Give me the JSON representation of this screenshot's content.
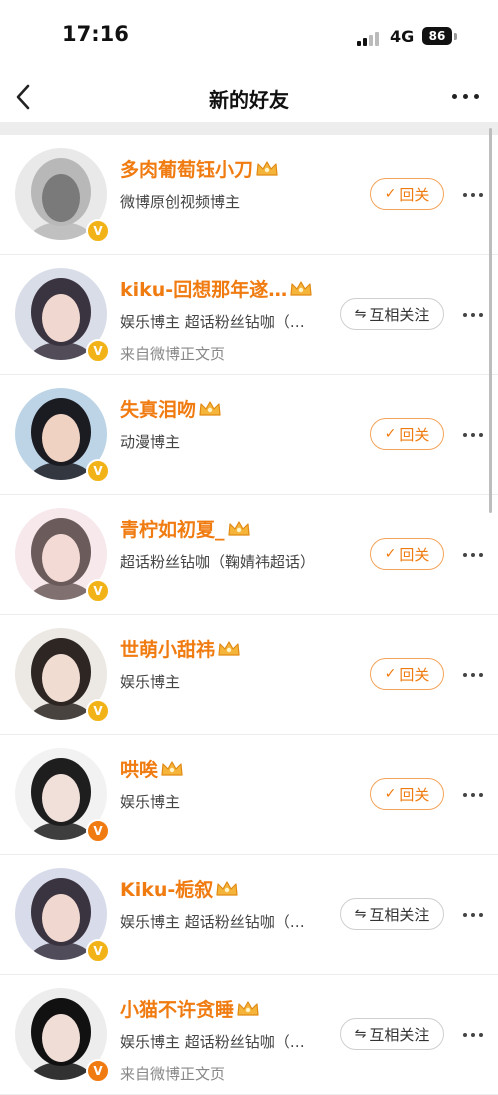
{
  "status_bar": {
    "time": "17:16",
    "network": "4G",
    "battery": "86"
  },
  "nav": {
    "title": "新的好友",
    "back_icon": "chevron-left-icon",
    "more_icon": "more-horizontal-icon"
  },
  "colors": {
    "accent": "#f07b10",
    "follow_border": "#f4a45a",
    "badge_yellow": "#f2b318",
    "badge_orange": "#f07b10"
  },
  "rows": [
    {
      "name": "多肉葡萄钰小刀",
      "desc": "微博原创视频博主",
      "source": "",
      "button": "回关",
      "button_type": "follow",
      "badge_color": "#f2b318"
    },
    {
      "name": "kiku-回想那年遂…",
      "desc": "娱乐博主 超话粉丝钻咖（…",
      "source": "来自微博正文页",
      "button": "互相关注",
      "button_type": "mutual",
      "badge_color": "#f2b318"
    },
    {
      "name": "失真泪吻",
      "desc": "动漫博主",
      "source": "",
      "button": "回关",
      "button_type": "follow",
      "badge_color": "#f2b318"
    },
    {
      "name": "青柠如初夏_",
      "desc": "超话粉丝钻咖（鞠婧祎超话）",
      "source": "",
      "button": "回关",
      "button_type": "follow",
      "badge_color": "#f2b318"
    },
    {
      "name": "世萌小甜祎",
      "desc": "娱乐博主",
      "source": "",
      "button": "回关",
      "button_type": "follow",
      "badge_color": "#f2b318"
    },
    {
      "name": "哄唉",
      "desc": "娱乐博主",
      "source": "",
      "button": "回关",
      "button_type": "follow",
      "badge_color": "#f07b10"
    },
    {
      "name": "Kiku-栀叙",
      "desc": "娱乐博主 超话粉丝钻咖（…",
      "source": "",
      "button": "互相关注",
      "button_type": "mutual",
      "badge_color": "#f2b318"
    },
    {
      "name": "小猫不许贪睡",
      "desc": "娱乐博主 超话粉丝钻咖（…",
      "source": "来自微博正文页",
      "button": "互相关注",
      "button_type": "mutual",
      "badge_color": "#f07b10"
    }
  ]
}
